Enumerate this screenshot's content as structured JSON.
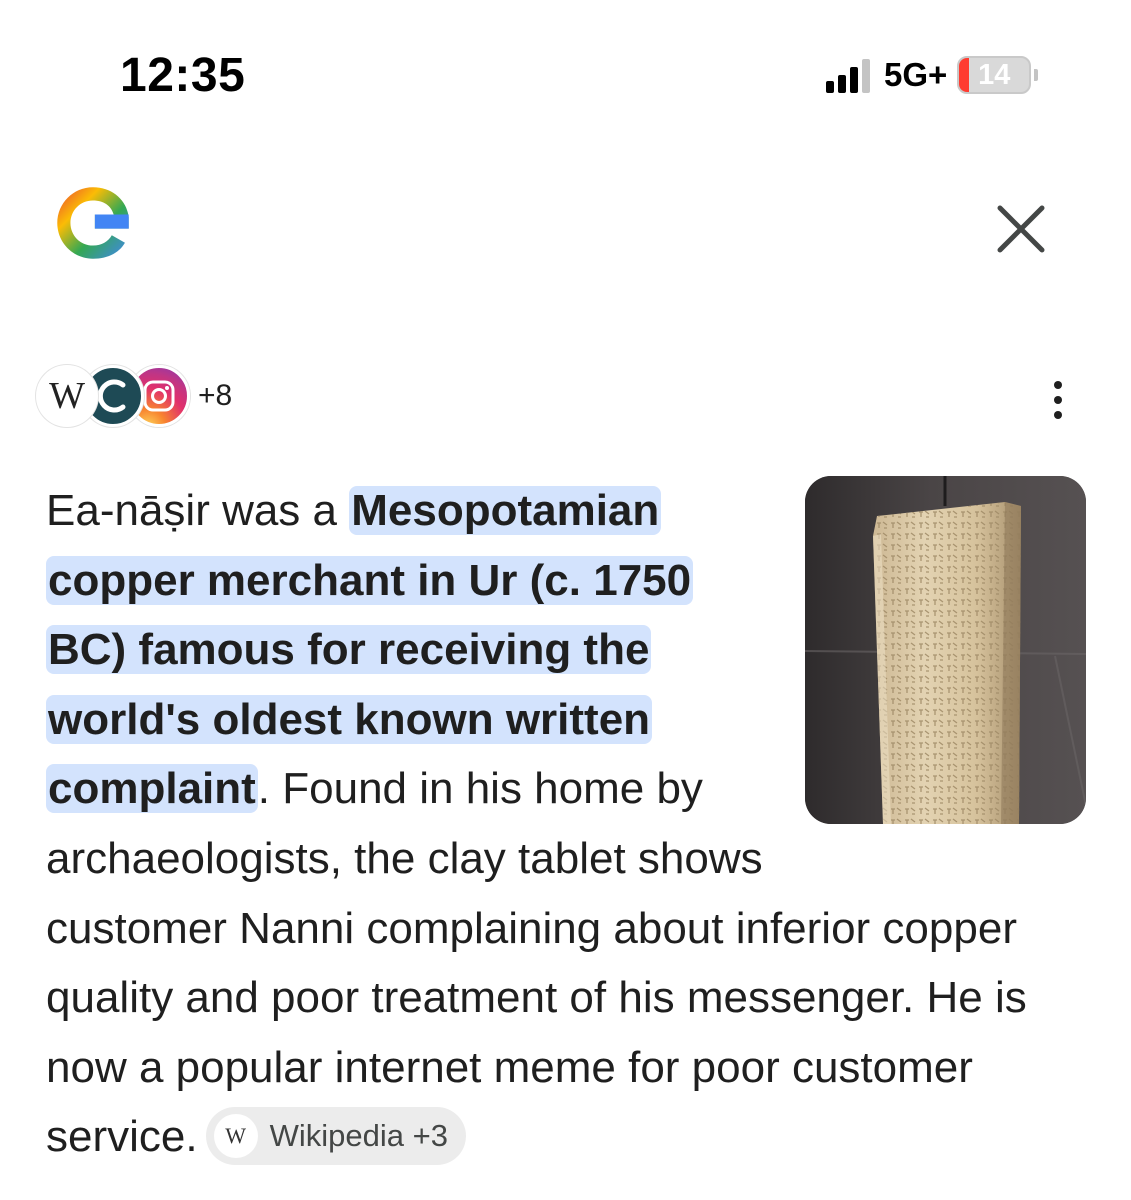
{
  "status_bar": {
    "time": "12:35",
    "signal_bars_active": 3,
    "signal_bars_total": 4,
    "network": "5G+",
    "battery_level": "14",
    "battery_color": "#ff3b30"
  },
  "header": {
    "logo_icon": "google-g-logo",
    "close_icon": "close-x-icon",
    "brand_colors": [
      "#ea4335",
      "#fbbc05",
      "#34a853",
      "#4285f4"
    ]
  },
  "sources": {
    "icons": [
      "wikipedia-icon",
      "site-c-icon",
      "instagram-icon"
    ],
    "wikipedia_glyph": "W",
    "more_count": "+8",
    "menu_icon": "more-vertical-icon"
  },
  "answer": {
    "intro": "Ea-nāṣir was a ",
    "highlight": "Mesopotamian copper merchant in Ur (c. 1750 BC) famous for receiving the world's oldest known written complaint",
    "body": ". Found in his home by archaeologists, the clay tablet shows customer Nanni complaining about inferior copper quality and poor treatment of his messenger. He is now a popular internet meme for poor customer service.",
    "highlight_color": "#d3e3fd",
    "image_subject": "clay tablet with cuneiform inscription"
  },
  "citation_chip": {
    "icon_glyph": "W",
    "label": "Wikipedia +3"
  }
}
